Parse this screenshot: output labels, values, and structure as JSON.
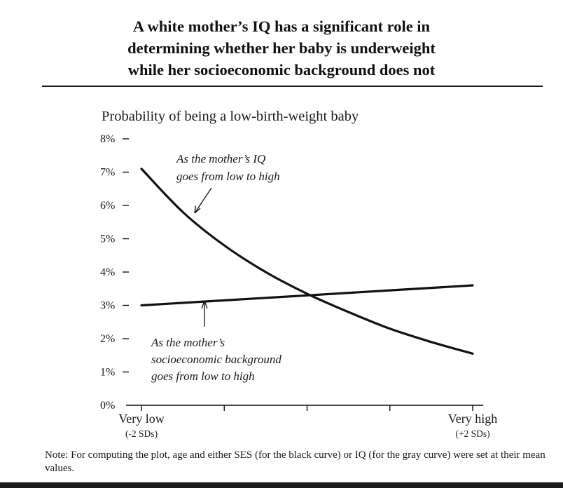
{
  "title": {
    "line1": "A white mother’s IQ has a significant role in",
    "line2": "determining whether her baby is underweight",
    "line3": "while her socioeconomic background does not"
  },
  "note": "Note: For computing the plot, age and either SES (for the black curve) or IQ (for the gray curve) were set at their mean values.",
  "chart_data": {
    "type": "line",
    "title": "Probability of being a low-birth-weight baby",
    "ylim": [
      0,
      8
    ],
    "xlim": [
      -2,
      2
    ],
    "y_ticks": [
      {
        "value": 0,
        "label": "0%"
      },
      {
        "value": 1,
        "label": "1%"
      },
      {
        "value": 2,
        "label": "2%"
      },
      {
        "value": 3,
        "label": "3%"
      },
      {
        "value": 4,
        "label": "4%"
      },
      {
        "value": 5,
        "label": "5%"
      },
      {
        "value": 6,
        "label": "6%"
      },
      {
        "value": 7,
        "label": "7%"
      },
      {
        "value": 8,
        "label": "8%"
      }
    ],
    "x_ticks": [
      -2,
      -1,
      0,
      1,
      2
    ],
    "x_labels": [
      {
        "value": -2,
        "main": "Very low",
        "sub": "(-2 SDs)"
      },
      {
        "value": 2,
        "main": "Very high",
        "sub": "(+2 SDs)"
      }
    ],
    "series": [
      {
        "x": [
          -2,
          -1.5,
          -1,
          -0.5,
          0,
          0.5,
          1,
          1.5,
          2
        ],
        "values": [
          7.1,
          5.8,
          4.8,
          4.0,
          3.35,
          2.8,
          2.3,
          1.9,
          1.55
        ],
        "color": "#111111"
      },
      {
        "x": [
          -2,
          -1,
          0,
          1,
          2
        ],
        "values": [
          3.0,
          3.15,
          3.3,
          3.45,
          3.6
        ],
        "color": "#111111"
      }
    ],
    "annotations": [
      {
        "lines": [
          "As the mother’s IQ",
          "goes from low to high"
        ]
      },
      {
        "lines": [
          "As the mother’s",
          "socioeconomic background",
          "goes from low to high"
        ]
      }
    ],
    "grid": false
  }
}
